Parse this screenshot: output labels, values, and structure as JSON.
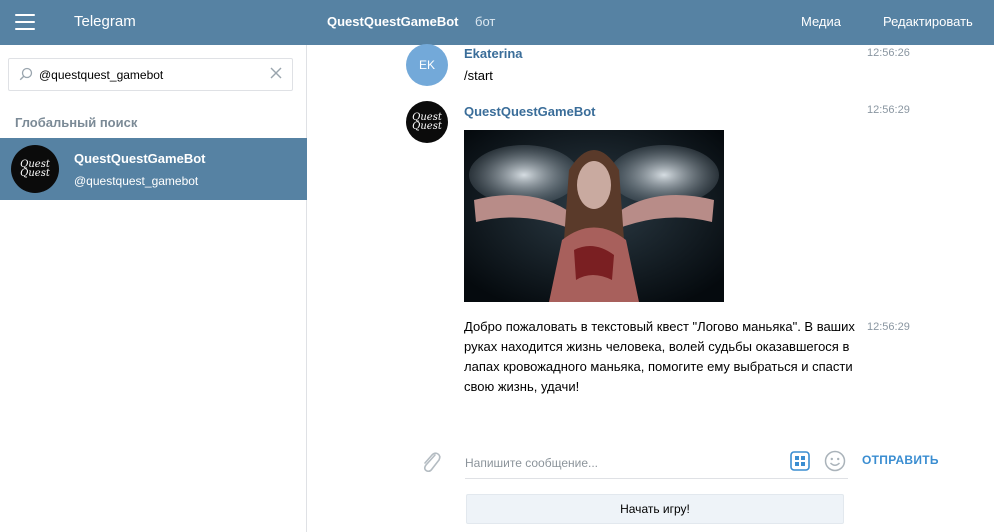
{
  "header": {
    "app_title": "Telegram",
    "chat_title": "QuestQuestGameBot",
    "chat_subtitle": "бот",
    "media_label": "Медиа",
    "edit_label": "Редактировать",
    "color": "#5682a3"
  },
  "sidebar": {
    "search_value": "@questquest_gamebot",
    "section_title": "Глобальный поиск",
    "results": [
      {
        "name": "QuestQuestGameBot",
        "handle": "@questquest_gamebot",
        "avatar_text": "Quest Quest"
      }
    ]
  },
  "messages": [
    {
      "sender": "Ekaterina",
      "avatar_initials": "EK",
      "time": "12:56:26",
      "text": "/start"
    },
    {
      "sender": "QuestQuestGameBot",
      "avatar_text": "Quest Quest",
      "time": "12:56:29",
      "has_photo": true
    },
    {
      "time": "12:56:29",
      "lines": [
        "Добро пожаловать в текстовый квест \"Логово маньяка\". В ваших",
        "руках находится жизнь человека, волей судьбы оказавшегося в",
        "лапах кровожадного маньяка, помогите ему выбраться и спасти",
        "свою жизнь, удачи!"
      ]
    }
  ],
  "composer": {
    "placeholder": "Напишите сообщение...",
    "send_label": "ОТПРАВИТЬ",
    "bot_button_label": "Начать игру!"
  },
  "colors": {
    "accent": "#3a8dd1",
    "sender": "#3a6d99",
    "selected": "#5682a3"
  }
}
